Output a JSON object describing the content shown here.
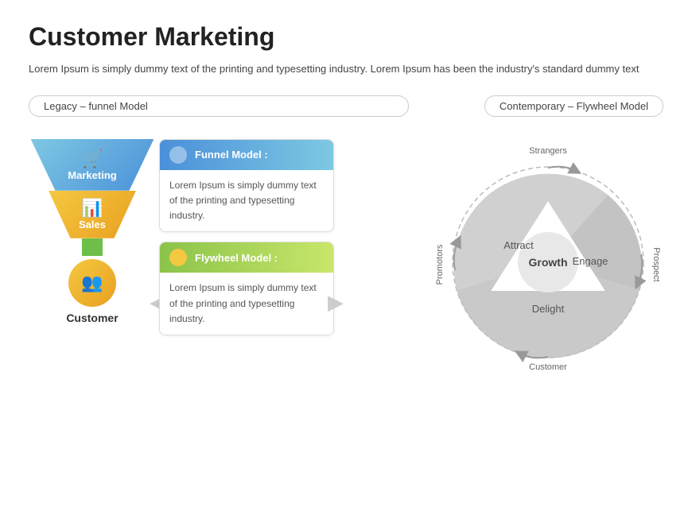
{
  "page": {
    "title": "Customer Marketing",
    "subtitle": "Lorem Ipsum is simply dummy text of the printing and typesetting industry. Lorem Ipsum has been the industry's standard dummy text"
  },
  "left_section": {
    "label": "Legacy – funnel Model"
  },
  "right_section": {
    "label": "Contemporary – Flywheel Model"
  },
  "funnel": {
    "marketing_label": "Marketing",
    "sales_label": "Sales",
    "customer_label": "Customer"
  },
  "cards": [
    {
      "id": "funnel-card",
      "header": "Funnel Model :",
      "body": "Lorem Ipsum is simply dummy text of the printing and typesetting industry."
    },
    {
      "id": "flywheel-card",
      "header": "Flywheel Model :",
      "body": "Lorem Ipsum is simply dummy text of the printing and typesetting industry."
    }
  ],
  "flywheel": {
    "center_label": "Growth",
    "attract_label": "Attract",
    "engage_label": "Engage",
    "delight_label": "Delight",
    "strangers_label": "Strangers",
    "promotors_label": "Promotors",
    "prospect_label": "Prospect",
    "customer_label": "Customer"
  }
}
